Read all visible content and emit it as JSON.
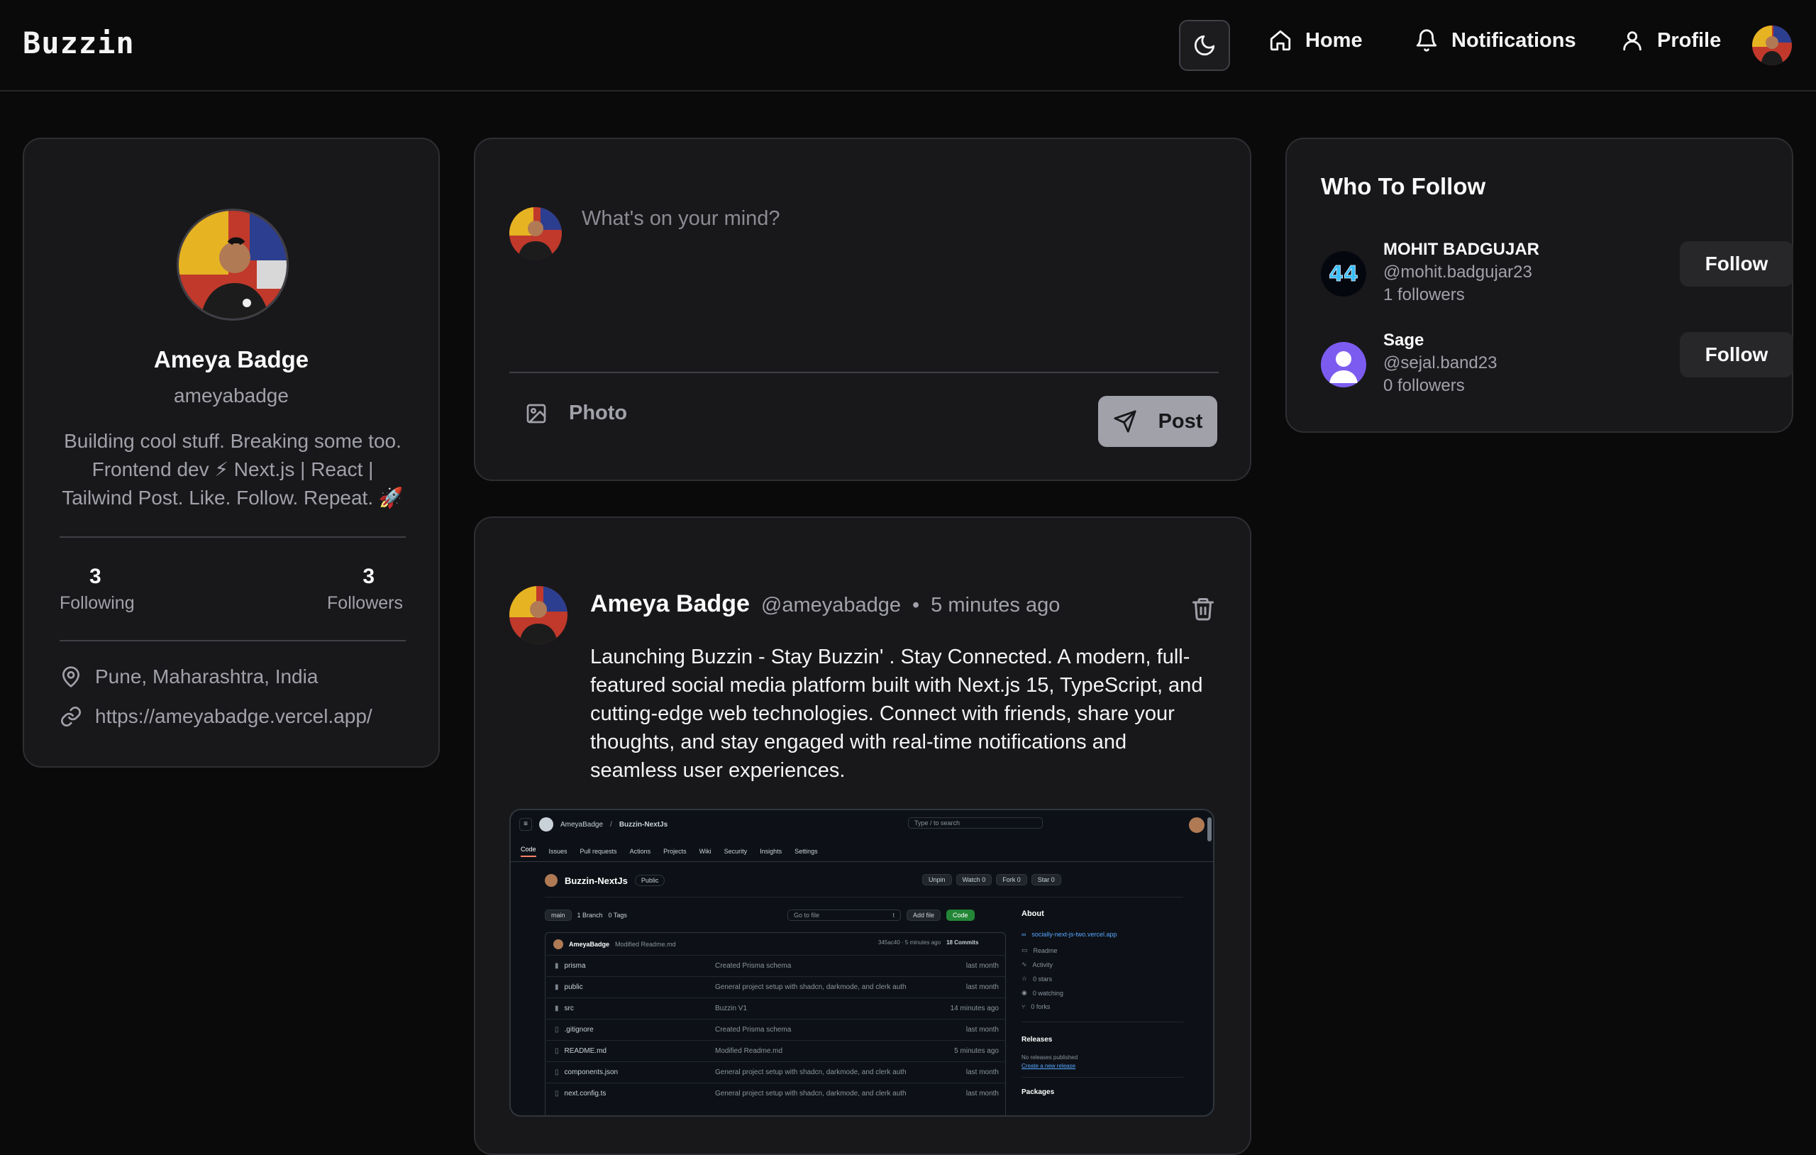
{
  "header": {
    "brand": "Buzzin",
    "nav": {
      "home": "Home",
      "notifications": "Notifications",
      "profile": "Profile"
    }
  },
  "profile": {
    "name": "Ameya Badge",
    "username": "ameyabadge",
    "bio": "Building cool stuff. Breaking some too. Frontend dev ⚡ Next.js | React | Tailwind Post. Like. Follow. Repeat. 🚀",
    "following_count": "3",
    "following_label": "Following",
    "followers_count": "3",
    "followers_label": "Followers",
    "location": "Pune, Maharashtra, India",
    "website": "https://ameyabadge.vercel.app/"
  },
  "composer": {
    "placeholder": "What's on your mind?",
    "photo_label": "Photo",
    "post_label": "Post"
  },
  "post": {
    "author": "Ameya Badge",
    "handle": "@ameyabadge",
    "separator": "•",
    "time": "5 minutes ago",
    "content": "Launching Buzzin - Stay Buzzin' . Stay Connected. A modern, full-featured social media platform built with Next.js 15, TypeScript, and cutting-edge web technologies. Connect with friends, share your thoughts, and stay engaged with real-time notifications and seamless user experiences.",
    "image": {
      "owner": "AmeyaBadge",
      "slash": "/",
      "repo": "Buzzin-NextJs",
      "search": "Type / to search",
      "tabs": [
        "Code",
        "Issues",
        "Pull requests",
        "Actions",
        "Projects",
        "Wiki",
        "Security",
        "Insights",
        "Settings"
      ],
      "visibility": "Public",
      "unpin": "Unpin",
      "watch": "Watch",
      "watch_count": "0",
      "fork": "Fork",
      "fork_count": "0",
      "star": "Star",
      "star_count": "0",
      "branch": "main",
      "branches": "1 Branch",
      "tags": "0 Tags",
      "goto": "Go to file",
      "goto_key": "t",
      "add_file": "Add file",
      "code_btn": "Code",
      "commit_author": "AmeyaBadge",
      "commit_msg": "Modified Readme.md",
      "commit_hash": "345ac40 · 5 minutes ago",
      "commits": "18 Commits",
      "files": [
        {
          "name": "prisma",
          "msg": "Created Prisma schema",
          "date": "last month",
          "type": "folder"
        },
        {
          "name": "public",
          "msg": "General project setup with shadcn, darkmode, and clerk auth",
          "date": "last month",
          "type": "folder"
        },
        {
          "name": "src",
          "msg": "Buzzin V1",
          "date": "14 minutes ago",
          "type": "folder"
        },
        {
          "name": ".gitignore",
          "msg": "Created Prisma schema",
          "date": "last month",
          "type": "file"
        },
        {
          "name": "README.md",
          "msg": "Modified Readme.md",
          "date": "5 minutes ago",
          "type": "file"
        },
        {
          "name": "components.json",
          "msg": "General project setup with shadcn, darkmode, and clerk auth",
          "date": "last month",
          "type": "file"
        },
        {
          "name": "next.config.ts",
          "msg": "General project setup with shadcn, darkmode, and clerk auth",
          "date": "last month",
          "type": "file"
        }
      ],
      "about_title": "About",
      "about_link": "socially-next-js-two.vercel.app",
      "about_items": [
        "Readme",
        "Activity",
        "0 stars",
        "0 watching",
        "0 forks"
      ],
      "releases_title": "Releases",
      "releases_none": "No releases published",
      "releases_create": "Create a new release",
      "packages_title": "Packages"
    }
  },
  "who_to_follow": {
    "title": "Who To Follow",
    "users": [
      {
        "name": "MOHIT BADGUJAR",
        "handle": "@mohit.badgujar23",
        "followers": "1 followers",
        "button": "Follow"
      },
      {
        "name": "Sage",
        "handle": "@sejal.band23",
        "followers": "0 followers",
        "button": "Follow"
      }
    ]
  },
  "colors": {
    "background": "#0a0a0a",
    "card": "#18181b",
    "border": "#2e2e33",
    "muted": "#a1a1aa"
  }
}
